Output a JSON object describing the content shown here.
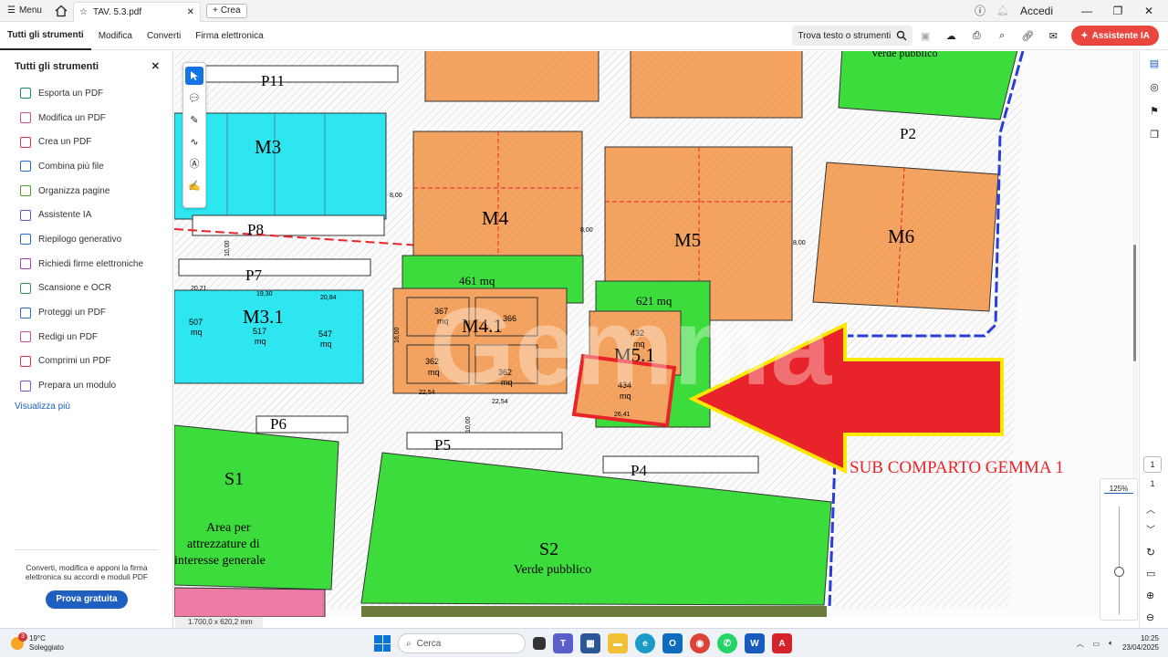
{
  "titlebar": {
    "menu_label": "Menu",
    "tab_title": "TAV. 5.3.pdf",
    "new_tab_label": "Crea",
    "login_label": "Accedi"
  },
  "menubar": {
    "tabs": [
      "Tutti gli strumenti",
      "Modifica",
      "Converti",
      "Firma elettronica"
    ],
    "find_label": "Trova testo o strumenti",
    "ai_label": "Assistente IA"
  },
  "sidebar": {
    "title": "Tutti gli strumenti",
    "items": [
      {
        "label": "Esporta un PDF",
        "color": "#1f8a70"
      },
      {
        "label": "Modifica un PDF",
        "color": "#d04a86"
      },
      {
        "label": "Crea un PDF",
        "color": "#d9363e"
      },
      {
        "label": "Combina più file",
        "color": "#2d6ad8"
      },
      {
        "label": "Organizza pagine",
        "color": "#4b9e2a"
      },
      {
        "label": "Assistente IA",
        "color": "#6b4fd8"
      },
      {
        "label": "Riepilogo generativo",
        "color": "#2d6ad8"
      },
      {
        "label": "Richiedi firme elettroniche",
        "color": "#a33fb5"
      },
      {
        "label": "Scansione e OCR",
        "color": "#2e9a4b"
      },
      {
        "label": "Proteggi un PDF",
        "color": "#2d6ad8"
      },
      {
        "label": "Redigi un PDF",
        "color": "#d04a86"
      },
      {
        "label": "Comprimi un PDF",
        "color": "#d9363e"
      },
      {
        "label": "Prepara un modulo",
        "color": "#8a4fd8"
      }
    ],
    "more_label": "Visualizza più",
    "promo_text": "Converti, modifica e apponi la firma elettronica su accordi e moduli PDF",
    "promo_button": "Prova gratuita"
  },
  "document": {
    "page_size": "1.700,0 x 620,2 mm",
    "plot_labels": {
      "P11": "P11",
      "P2": "P2",
      "P8": "P8",
      "P7": "P7",
      "P6": "P6",
      "P5": "P5",
      "P4": "P4",
      "M3": "M3",
      "M4": "M4",
      "M5": "M5",
      "M6": "M6",
      "M31": "M3.1",
      "M41": "M4.1",
      "M51": "M5.1",
      "S1": "S1",
      "S2": "S2"
    },
    "areas": {
      "a461": "461 mq",
      "a621": "621 mq",
      "l507": "507",
      "l517": "517",
      "l547": "547",
      "l367": "367",
      "l366": "366",
      "l362a": "362",
      "l362b": "362",
      "l432": "432",
      "l434": "434",
      "mq": "mq"
    },
    "dims": {
      "d800a": "8,00",
      "d800b": "8,00",
      "d800c": "8,00",
      "d1000a": "10,00",
      "d1000b": "10,00",
      "d2254a": "22,54",
      "d2254b": "22,54",
      "d2641": "26,41",
      "d1600": "16,00",
      "d2021": "20,21",
      "d1930": "19,30",
      "d2084": "20,84"
    },
    "texts": {
      "verde_top": "Verde pubblico",
      "verde_s2": "Verde pubblico",
      "s1_l1": "Area per",
      "s1_l2": "attrezzature di",
      "s1_l3": "interesse generale",
      "sub": "SUB COMPARTO GEMMA 1"
    },
    "colors": {
      "orange": "#f4a460",
      "cyan": "#2ee6f0",
      "green": "#3ddc3d",
      "red": "#e8232a",
      "yellow": "#ffe800",
      "pink": "#ee7aa6"
    }
  },
  "viewer_controls": {
    "page_number": "1",
    "page_total": "1",
    "zoom": "125%"
  },
  "taskbar": {
    "temperature": "19°C",
    "weather": "Soleggiato",
    "weather_badge": "3",
    "search_placeholder": "Cerca",
    "time": "10:25",
    "date": "23/04/2025"
  }
}
